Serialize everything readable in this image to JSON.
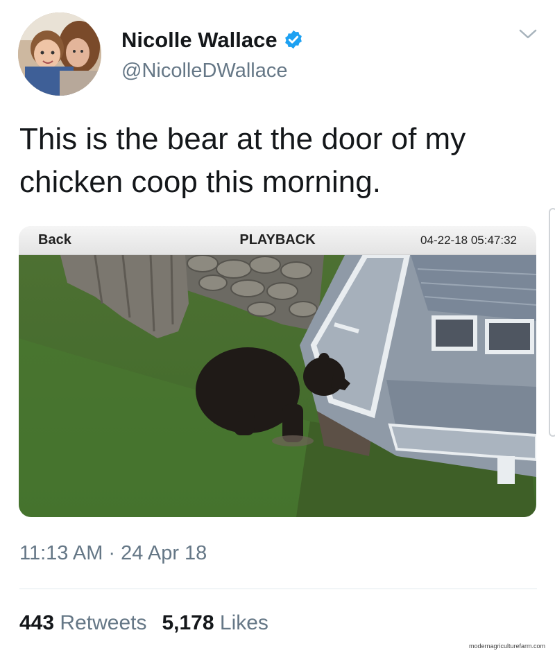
{
  "author": {
    "name": "Nicolle Wallace",
    "handle": "@NicolleDWallace",
    "verified_icon": "verified-badge-icon",
    "verified_color": "#1da1f2"
  },
  "tweet": {
    "text": "This is the bear at the door of my chicken coop this morning."
  },
  "media": {
    "back_label": "Back",
    "title": "PLAYBACK",
    "datetime": "04-22-18 05:47:32"
  },
  "meta": {
    "timestamp": "11:13 AM · 24 Apr 18",
    "retweets_count": "443",
    "retweets_label": "Retweets",
    "likes_count": "5,178",
    "likes_label": "Likes"
  },
  "watermark": "modernagriculturefarm.com",
  "colors": {
    "text": "#14171a",
    "secondary": "#657786",
    "divider": "#e1e8ed"
  }
}
